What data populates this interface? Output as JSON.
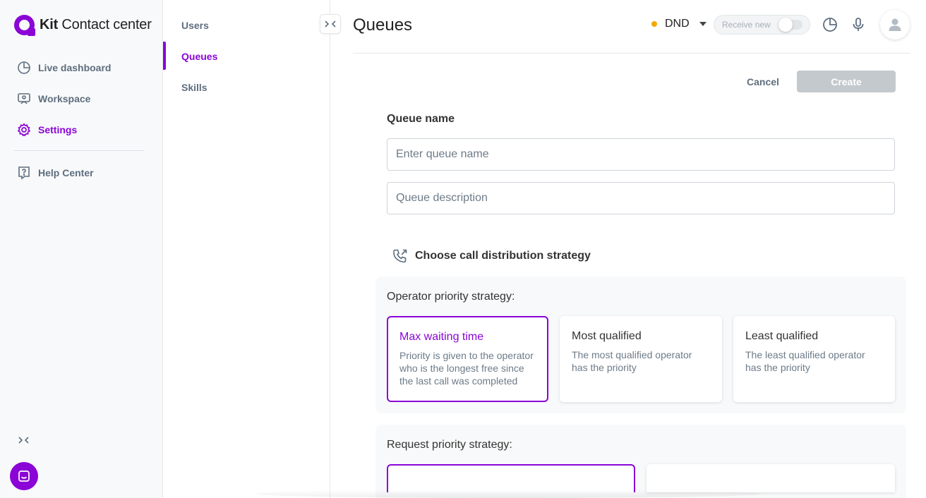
{
  "brand": {
    "name_bold": "Kit",
    "name_rest": "Contact center",
    "color": "#8a05d6"
  },
  "sidebar": {
    "items": [
      {
        "label": "Live dashboard",
        "icon": "pie-chart-icon"
      },
      {
        "label": "Workspace",
        "icon": "workspace-icon"
      },
      {
        "label": "Settings",
        "icon": "gear-icon",
        "active": true
      },
      {
        "label": "Help Center",
        "icon": "help-icon"
      }
    ]
  },
  "submenu": {
    "items": [
      {
        "label": "Users"
      },
      {
        "label": "Queues",
        "active": true
      },
      {
        "label": "Skills"
      }
    ]
  },
  "header": {
    "title": "Queues",
    "status": "DND",
    "status_color": "#f2a900",
    "receive_label": "Receive new"
  },
  "actions": {
    "cancel": "Cancel",
    "create": "Create"
  },
  "form": {
    "queue_name_label": "Queue name",
    "queue_name_placeholder": "Enter queue name",
    "queue_name_value": "",
    "description_placeholder": "Queue description",
    "description_value": "",
    "strategy_heading": "Choose call distribution strategy"
  },
  "operator_strategy": {
    "title": "Operator priority strategy:",
    "options": [
      {
        "title": "Max waiting time",
        "desc": "Priority is given to the operator who is the longest free since the last call was completed",
        "selected": true
      },
      {
        "title": "Most qualified",
        "desc": "The most qualified operator has the priority",
        "selected": false
      },
      {
        "title": "Least qualified",
        "desc": "The least qualified operator has the priority",
        "selected": false
      }
    ]
  },
  "request_strategy": {
    "title": "Request priority strategy:"
  }
}
